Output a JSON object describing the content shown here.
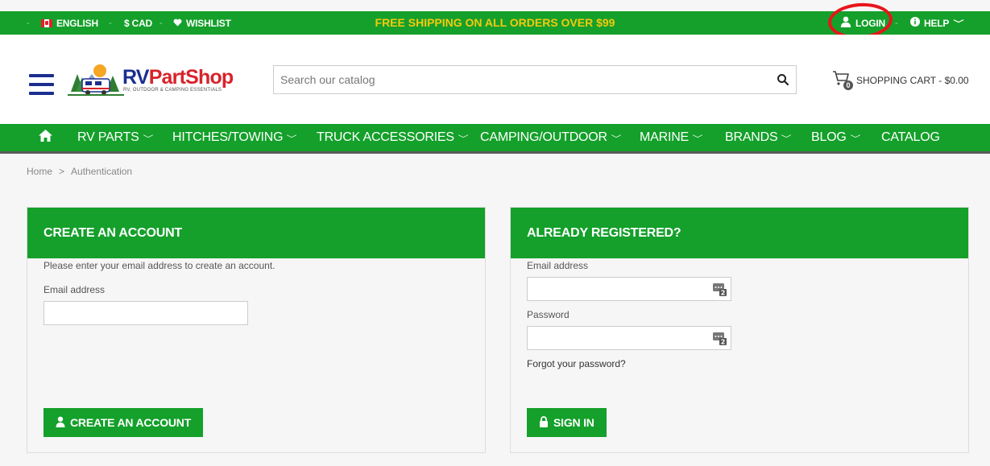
{
  "topbar": {
    "language": "ENGLISH",
    "currency": "$ CAD",
    "wishlist": "WISHLIST",
    "promo": "FREE SHIPPING ON ALL ORDERS OVER $99",
    "login": "LOGIN",
    "help": "HELP",
    "separator": "-"
  },
  "header": {
    "logo_rv": "RV",
    "logo_partshop": "PartShop",
    "logo_tagline": "RV, OUTDOOR & CAMPING ESSENTIALS",
    "search_placeholder": "Search our catalog",
    "cart_count": "0",
    "cart_label": "SHOPPING CART - $0.00"
  },
  "nav": {
    "items": [
      {
        "label": "RV PARTS"
      },
      {
        "label": "HITCHES/TOWING"
      },
      {
        "label": "TRUCK ACCESSORIES"
      },
      {
        "label": "CAMPING/OUTDOOR"
      },
      {
        "label": "MARINE"
      },
      {
        "label": "BRANDS"
      },
      {
        "label": "BLOG"
      },
      {
        "label": "CATALOG"
      }
    ]
  },
  "breadcrumb": {
    "home": "Home",
    "separator": ">",
    "current": "Authentication"
  },
  "create_account": {
    "title": "CREATE AN ACCOUNT",
    "intro": "Please enter your email address to create an account.",
    "email_label": "Email address",
    "email_value": "",
    "button": "CREATE AN ACCOUNT"
  },
  "login": {
    "title": "ALREADY REGISTERED?",
    "email_label": "Email address",
    "email_value": "",
    "password_label": "Password",
    "password_value": "",
    "forgot": "Forgot your password?",
    "button": "SIGN IN"
  },
  "colors": {
    "brand_green": "#14a02a",
    "promo_yellow": "#f6c90e",
    "logo_blue": "#1b2e8f",
    "logo_red": "#d8232a",
    "annotation_red": "#e8141b"
  }
}
